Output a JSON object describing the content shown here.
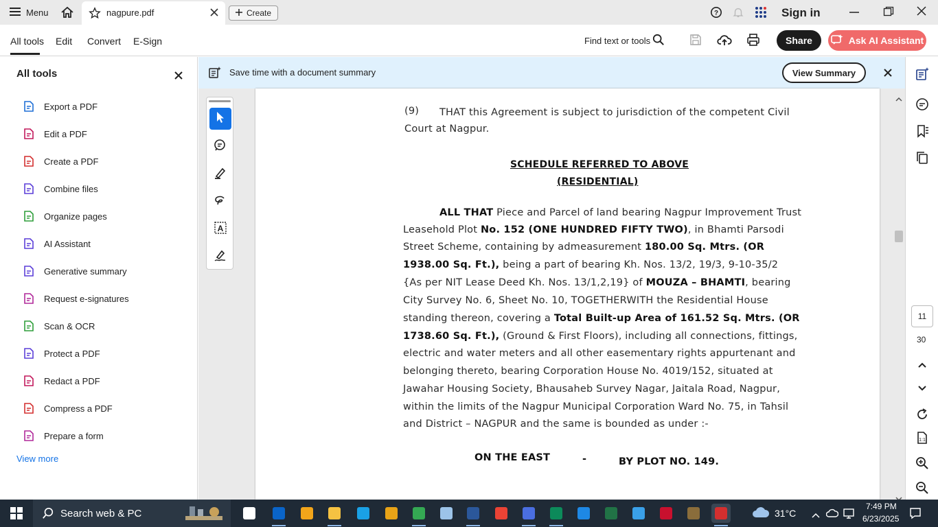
{
  "titlebar": {
    "menu_label": "Menu",
    "tab_title": "nagpure.pdf",
    "create_label": "Create",
    "sign_in_label": "Sign in"
  },
  "toolbar": {
    "tabs": [
      "All tools",
      "Edit",
      "Convert",
      "E-Sign"
    ],
    "find_label": "Find text or tools",
    "share_label": "Share",
    "ai_label": "Ask AI Assistant"
  },
  "leftpanel": {
    "title": "All tools",
    "items": [
      {
        "label": "Export a PDF",
        "icon": "export-pdf-icon",
        "color": "#1f6fd6"
      },
      {
        "label": "Edit a PDF",
        "icon": "edit-pdf-icon",
        "color": "#c2185b"
      },
      {
        "label": "Create a PDF",
        "icon": "create-pdf-icon",
        "color": "#d32f2f"
      },
      {
        "label": "Combine files",
        "icon": "combine-files-icon",
        "color": "#5b3fd8"
      },
      {
        "label": "Organize pages",
        "icon": "organize-pages-icon",
        "color": "#2e9e3a"
      },
      {
        "label": "AI Assistant",
        "icon": "ai-assistant-icon",
        "color": "#5b3fd8"
      },
      {
        "label": "Generative summary",
        "icon": "generative-summary-icon",
        "color": "#5b3fd8"
      },
      {
        "label": "Request e-signatures",
        "icon": "request-esign-icon",
        "color": "#b0299a"
      },
      {
        "label": "Scan & OCR",
        "icon": "scan-ocr-icon",
        "color": "#2e9e3a"
      },
      {
        "label": "Protect a PDF",
        "icon": "protect-pdf-icon",
        "color": "#5b3fd8"
      },
      {
        "label": "Redact a PDF",
        "icon": "redact-pdf-icon",
        "color": "#c2185b"
      },
      {
        "label": "Compress a PDF",
        "icon": "compress-pdf-icon",
        "color": "#d32f2f"
      },
      {
        "label": "Prepare a form",
        "icon": "prepare-form-icon",
        "color": "#b0299a"
      }
    ],
    "view_more": "View more"
  },
  "banner": {
    "text": "Save time with a document summary",
    "button": "View Summary"
  },
  "document": {
    "clause9_num": "(9)",
    "clause9_line1": "THAT this Agreement is subject to jurisdiction of the competent Civil",
    "clause9_line2": "Court at Nagpur.",
    "schedule_title": "SCHEDULE REFERRED TO ABOVE",
    "schedule_sub": "(RESIDENTIAL)",
    "para_lines": [
      "<b>ALL THAT</b> Piece and Parcel of land bearing Nagpur Improvement Trust",
      "Leasehold Plot <b>No. 152 (ONE HUNDRED FIFTY TWO)</b>, in Bhamti Parsodi",
      "Street Scheme, containing by admeasurement <b>180.00 Sq. Mtrs. (OR</b>",
      "<b>1938.00 Sq. Ft.),</b> being a part of bearing Kh. Nos. 13/2, 19/3, 9-10-35/2",
      "{As per NIT Lease Deed Kh. Nos. 13/1,2,19} of <b>MOUZA – BHAMTI</b>, bearing",
      "City Survey No. 6, Sheet No. 10, TOGETHERWITH the Residential House",
      "standing thereon, covering a <b>Total Built-up Area of 161.52 Sq. Mtrs. (OR</b>",
      "<b>1738.60 Sq. Ft.),</b> (Ground &amp; First Floors), including all connections, fittings,",
      "electric and water meters and all other easementary rights appurtenant and",
      "belonging thereto, bearing Corporation House No. 4019/152, situated at",
      "Jawahar Housing Society, Bhausaheb Survey Nagar, Jaitala Road, Nagpur,",
      "within the limits of the Nagpur Municipal Corporation Ward No. 75, in Tahsil",
      "and District – NAGPUR and the same is bounded as under :-"
    ],
    "east_label": "ON THE EAST",
    "east_dash": "-",
    "east_value": "BY PLOT NO. 149."
  },
  "pagenav": {
    "current": "11",
    "total": "30"
  },
  "taskbar": {
    "search_placeholder": "Search web & PC",
    "weather": "31°C",
    "time": "7:49 PM",
    "date": "6/23/2025"
  },
  "colors": {
    "accent_blue": "#1473e6",
    "ai_button": "#f06a6a",
    "banner_bg": "#e0f1fd",
    "taskbar_bg": "#1f2a36"
  }
}
